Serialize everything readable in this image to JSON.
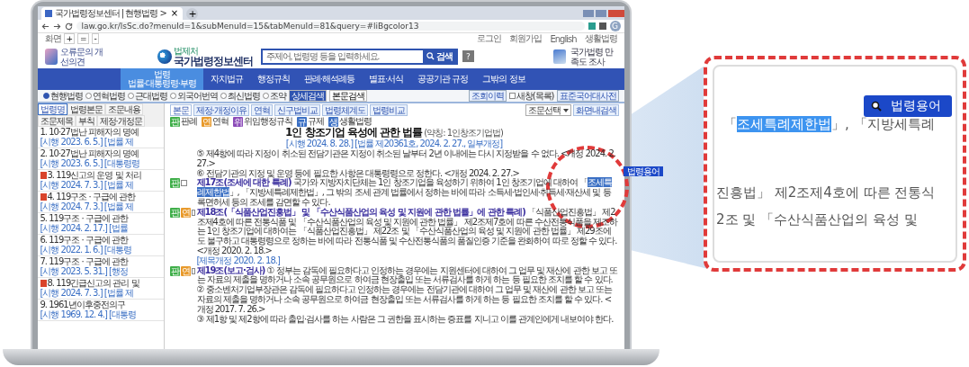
{
  "browser": {
    "tab_title": "국가법령정보센터 | 현행법령 >",
    "tab_close": "×",
    "new_tab": "+",
    "url": "law.go.kr/lsSc.do?menuId=1&subMenuId=15&tabMenuId=81&query=#liBgcolor13",
    "profile": "G"
  },
  "top_bar": {
    "zoom_label": "화면",
    "zoom_buttons": [
      "+",
      "=",
      "-"
    ],
    "links": [
      "로그인",
      "회원가입",
      "English",
      "생활법령"
    ]
  },
  "header": {
    "feedback": "오류문의 개선의견",
    "org": "법제처",
    "site_name": "국가법령정보센터",
    "search_placeholder": "주제어, 법령명 등을 입력하세요.",
    "search_button": "검색",
    "help": "?",
    "survey": "국가법령 만족도 조사"
  },
  "nav": [
    {
      "label": "법령",
      "sub": "법률·대통령령·부령",
      "selected": true
    },
    {
      "label": "자치법규",
      "selected": false
    },
    {
      "label": "행정규칙",
      "selected": false
    },
    {
      "label": "판례·해석례등",
      "selected": false
    },
    {
      "label": "별표·서식",
      "selected": false
    },
    {
      "label": "공공기관 규정",
      "selected": false
    },
    {
      "label": "그밖의 정보",
      "selected": false
    }
  ],
  "scope_options": [
    {
      "label": "현행법령",
      "selected": true
    },
    {
      "label": "연혁법령",
      "selected": false
    },
    {
      "label": "근대법령",
      "selected": false
    },
    {
      "label": "외국어번역",
      "selected": false
    },
    {
      "label": "최신법령",
      "selected": false
    },
    {
      "label": "조약",
      "selected": false
    }
  ],
  "search_buttons": [
    "상세검색",
    "본문검색"
  ],
  "tools": [
    {
      "kind": "button",
      "label": "조회이력"
    },
    {
      "kind": "checkbox",
      "label": "새창(목록)",
      "checked": false
    },
    {
      "kind": "button",
      "label": "표준국어대사전"
    }
  ],
  "left_tabs": [
    {
      "label": "법령명",
      "selected": true
    },
    {
      "label": "법령본문",
      "selected": false
    },
    {
      "label": "조문내용",
      "selected": false
    },
    {
      "label": "조문제목",
      "selected": false
    },
    {
      "label": "부칙",
      "selected": false
    },
    {
      "label": "제정·개정문",
      "selected": false
    }
  ],
  "results": [
    {
      "title": "1. 10·27법난 피해자의 명예",
      "meta": "[시행 2023. 6. 5.] [법률 제",
      "flagged": false
    },
    {
      "title": "2. 10·27법난 피해자의 명예",
      "meta": "[시행 2023. 6. 5.] [대통령령",
      "flagged": false
    },
    {
      "title": "3. 119신고의 운영 및 처리",
      "meta": "[시행 2024. 7. 3.] [법률 제",
      "flagged": true
    },
    {
      "title": "4. 119구조 · 구급에 관한",
      "meta": "[시행 2024. 7. 3.] [법률 제",
      "flagged": true
    },
    {
      "title": "5. 119구조 · 구급에 관한",
      "meta": "[시행 2024. 2. 17.] [법률",
      "flagged": false
    },
    {
      "title": "6. 119구조 · 구급에 관한",
      "meta": "[시행 2022. 1. 6.] [대통령",
      "flagged": false
    },
    {
      "title": "7. 119구조 · 구급에 관한",
      "meta": "[시행 2023. 5. 31.] [행정",
      "flagged": false
    },
    {
      "title": "8. 119긴급신고의 관리 및",
      "meta": "[시행 2024. 7. 3.] [법률 제",
      "flagged": true
    },
    {
      "title": "9. 1961년이후중전의구",
      "meta": "[시행 1969. 12. 4.] [대통령",
      "flagged": false
    }
  ],
  "doc_buttons": [
    "본문",
    "제정·개정이유",
    "연혁",
    "신구법비교",
    "법령체계도",
    "법령비교"
  ],
  "doc_tools": {
    "select": "조문선택",
    "find": "화면내검색"
  },
  "legend": [
    {
      "mark": "판",
      "label": "판례",
      "color": "#3fae49"
    },
    {
      "mark": "연",
      "label": "연혁",
      "color": "#e89a2c"
    },
    {
      "mark": "위",
      "label": "위임행정규칙",
      "color": "#8b4bb8"
    },
    {
      "mark": "규",
      "label": "규제",
      "color": "#3a6fc4"
    },
    {
      "mark": "생",
      "label": "생활법령",
      "color": "#3a6fc4"
    }
  ],
  "law": {
    "title": "1인 창조기업 육성에 관한 법률",
    "short_name": "(약칭: 1인창조기업법)",
    "info": "[시행 2024. 8. 28.] [법률 제20361호, 2024. 2. 27., 일부개정]"
  },
  "paragraphs": [
    {
      "kind": "clause",
      "text": "⑤ 제4항에 따라 지정이 취소된 전담기관은 지정이 취소된 날부터 2년 이내에는 다시 지정받을 수 없다. <개정 2024. 2. 27.>"
    },
    {
      "kind": "clause",
      "text": "⑥ 전담기관의 지정 및 운영 등에 필요한 사항은 대통령령으로 정한다. <개정 2024. 2. 27.>"
    },
    {
      "kind": "article",
      "checked": false,
      "badges": [
        {
          "mark": "판",
          "color": "#3fae49"
        }
      ],
      "heading": "제17조(조세에 대한 특례)",
      "text": "국가와 지방자치단체는 1인 창조기업을 육성하기 위하여 1인 창조기업에 대하여 「",
      "selection": "조세특례제한법",
      "text_after": "」, 「지방세특례제한법」, 그 밖의 조세 관계 법률에서 정하는 바에 따라 소득세·법인세·취득세·재산세 및 등록면허세 등의 조세를 감면할 수 있다."
    },
    {
      "kind": "article",
      "checked": false,
      "badges": [
        {
          "mark": "판",
          "color": "#3fae49"
        },
        {
          "mark": "연",
          "color": "#e89a2c"
        }
      ],
      "heading": "제18조(「식품산업진흥법」 및 「수산식품산업의 육성 및 지원에 관한 법률」에 관한 특례)",
      "text": "「식품산업진흥법」 제2조제4호에 따른 전통식품 및 「수산식품산업의 육성 및 지원에 관한 법률」 제2조제7호에 따른 수산전통식품을 제조하는 1인 창조기업에 대하여는 「식품산업진흥법」 제22조 및 「수산식품산업의 육성 및 지원에 관한 법률」 제29조에도 불구하고 대통령령으로 정하는 바에 따라 전통식품 및 수산전통식품의 품질인증 기준을 완화하여 따로 정할 수 있다. <개정 2020. 2. 18.>"
    },
    {
      "kind": "note",
      "text": "[제목개정 2020. 2. 18.]"
    },
    {
      "kind": "article",
      "checked": false,
      "badges": [
        {
          "mark": "판",
          "color": "#3fae49"
        },
        {
          "mark": "연",
          "color": "#e89a2c"
        }
      ],
      "heading": "제19조(보고·검사)",
      "text": "① 정부는 감독에 필요하다고 인정하는 경우에는 지원센터에 대하여 그 업무 및 재산에 관한 보고 또는 자료의 제출을 명하거나 소속 공무원으로 하여금 현장출입 또는 서류검사를 하게 하는 등 필요한 조치를 할 수 있다."
    },
    {
      "kind": "clause",
      "text": "② 중소벤처기업부장관은 감독에 필요하다고 인정하는 경우에는 전담기관에 대하여 그 업무 및 재산에 관한 보고 또는 자료의 제출을 명하거나 소속 공무원으로 하여금 현장출입 또는 서류검사를 하게 하는 등 필요한 조치를 할 수 있다. <개정 2017. 7. 26.>"
    },
    {
      "kind": "clause",
      "text": "③ 제1항 및 제2항에 따라 출입·검사를 하는 사람은 그 권한을 표시하는 증표를 지니고 이를 관계인에게 내보여야 한다."
    }
  ],
  "term_popup": "법령용어",
  "callout": {
    "button": "법령용어",
    "lines": [
      {
        "before": "「",
        "selection": "조세특례제한법",
        "after": "」, 「지방세특례"
      },
      {
        "before": "진흥법」 제2조제4호에 따른 전통식"
      },
      {
        "before": "2조 및 「수산식품산업의 육성 및"
      }
    ]
  }
}
